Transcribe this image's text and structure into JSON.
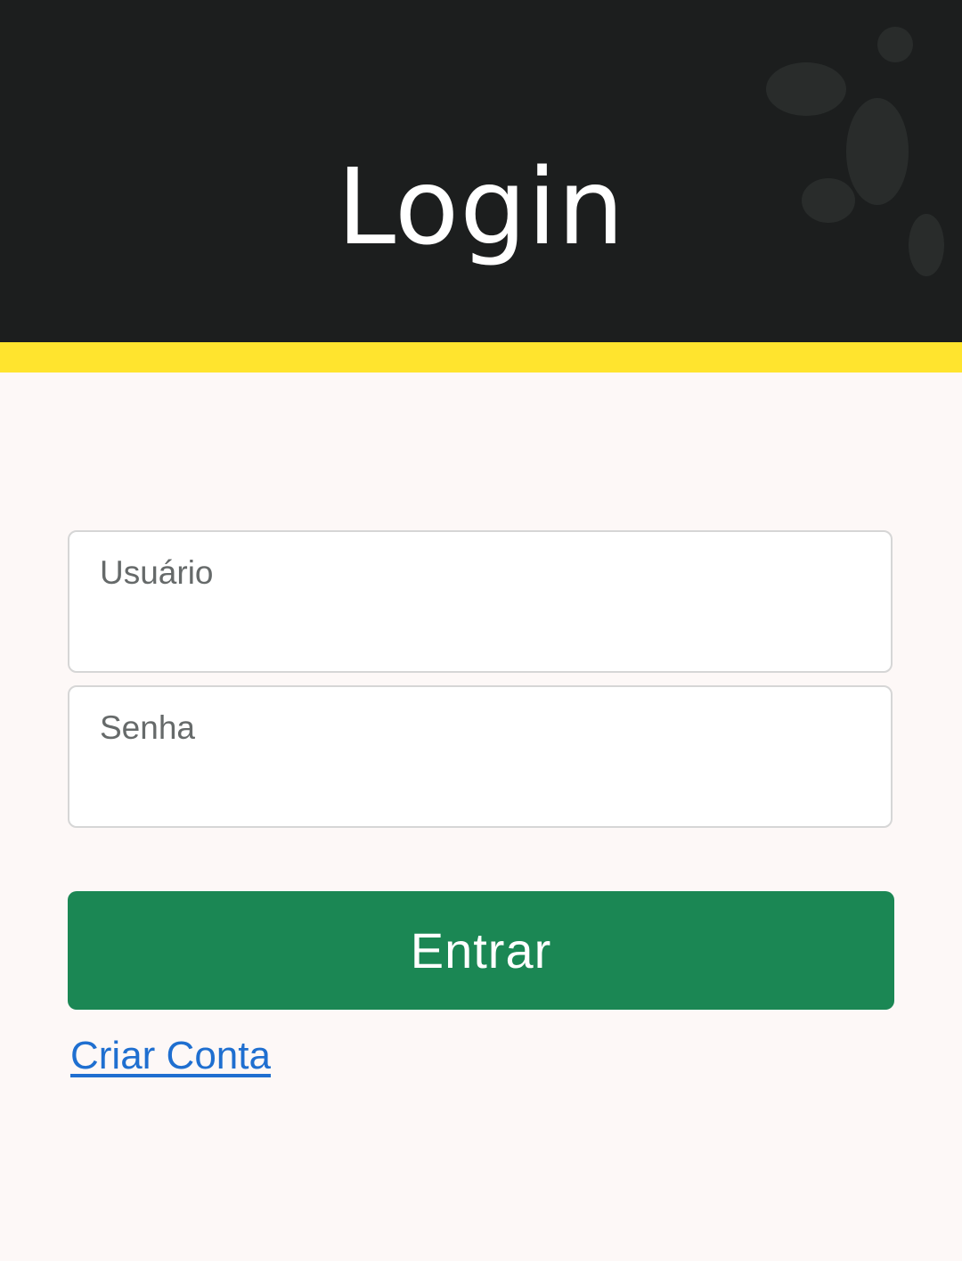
{
  "header": {
    "title": "Login"
  },
  "form": {
    "username": {
      "placeholder": "Usuário",
      "value": ""
    },
    "password": {
      "placeholder": "Senha",
      "value": ""
    },
    "submit_label": "Entrar",
    "create_account_label": "Criar Conta"
  },
  "colors": {
    "header_bg": "#1c1e1e",
    "accent_bar": "#ffe42e",
    "page_bg": "#fdf8f7",
    "button_bg": "#1b8754",
    "link": "#1f6fd0"
  }
}
